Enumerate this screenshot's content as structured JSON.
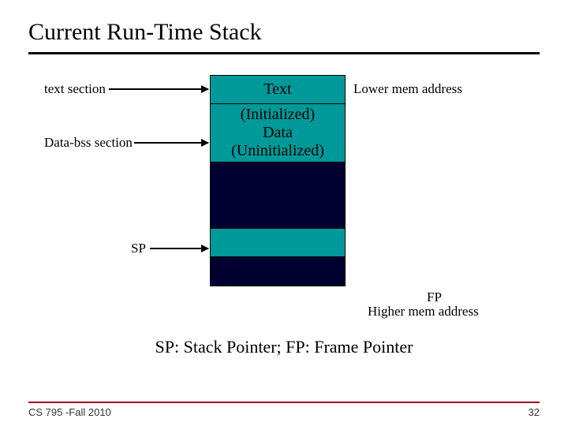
{
  "title": "Current Run-Time Stack",
  "labels": {
    "text_section": "text section",
    "data_bss_section": "Data-bss section",
    "sp": "SP",
    "lower_mem": "Lower mem address",
    "fp": "FP",
    "higher_mem": "Higher mem address"
  },
  "segments": {
    "text": "Text",
    "data_init": "(Initialized)",
    "data_mid": "Data",
    "data_uninit": "(Uninitialized)"
  },
  "caption": "SP: Stack Pointer; FP: Frame Pointer",
  "footer": {
    "left": "CS 795 -Fall 2010",
    "right": "32"
  }
}
